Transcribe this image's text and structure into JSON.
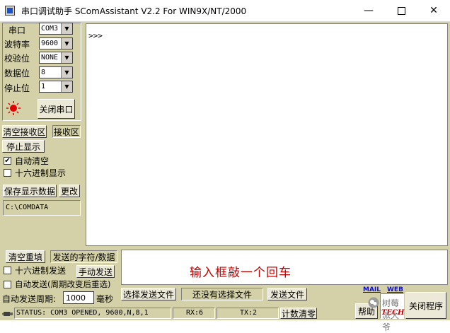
{
  "window": {
    "title": "串口调试助手 SComAssistant V2.2 For WIN9X/NT/2000"
  },
  "settings": {
    "port_label": "串口",
    "port_value": "COM3",
    "baud_label": "波特率",
    "baud_value": "9600",
    "parity_label": "校验位",
    "parity_value": "NONE",
    "databits_label": "数据位",
    "databits_value": "8",
    "stopbits_label": "停止位",
    "stopbits_value": "1"
  },
  "controls": {
    "close_port": "关闭串口",
    "clear_rx": "清空接收区",
    "rx_area": "接收区",
    "stop_display": "停止显示",
    "auto_clear": "自动清空",
    "auto_clear_checked": true,
    "hex_display": "十六进制显示",
    "hex_display_checked": false,
    "save_data": "保存显示数据",
    "change": "更改",
    "save_path": "C:\\COMDATA"
  },
  "receive": {
    "text": ">>>"
  },
  "send": {
    "clear_resend": "清空重填",
    "send_chars_label": "发送的字符/数据",
    "hex_send": "十六进制发送",
    "manual_send": "手动发送",
    "auto_send": "自动发送(周期改变后重选)",
    "period_label": "自动发送周期:",
    "period_value": "1000",
    "period_unit": "毫秒",
    "choose_file": "选择发送文件",
    "file_status": "还没有选择文件",
    "send_file": "发送文件",
    "input_text": "输入框敲一个回车"
  },
  "status": {
    "main": "STATUS: COM3 OPENED, 9600,N,8,1",
    "rx": "RX:6",
    "tx": "TX:2",
    "reset_count": "计数清零"
  },
  "help": {
    "mail": "MAIL",
    "web": "WEB",
    "tech": "TECH",
    "help_button": "帮助",
    "close_program": "关闭程序"
  },
  "watermark": "树莓派大爷",
  "colors": {
    "led": "#e00000",
    "tech": "#c00000",
    "link": "#1010c0"
  }
}
